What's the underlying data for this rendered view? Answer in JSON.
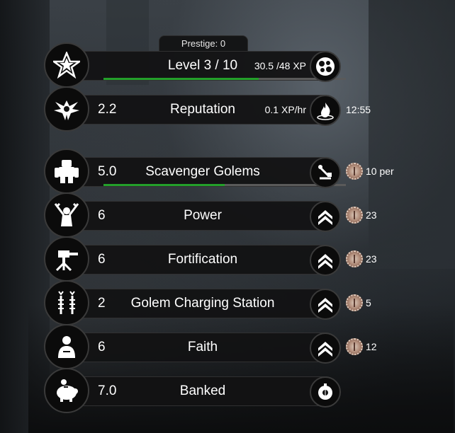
{
  "prestige": "Prestige: 0",
  "level": {
    "title": "Level 3 / 10",
    "xp": "30.5 /48 XP",
    "progress": 0.64
  },
  "reputation": {
    "value": "2.2",
    "title": "Reputation",
    "rate": "0.1 XP/hr",
    "timer": "12:55"
  },
  "golems": {
    "value": "5.0",
    "title": "Scavenger Golems",
    "cost": "10 per",
    "progress": 0.5
  },
  "upgrades": [
    {
      "value": "6",
      "title": "Power",
      "cost": "23"
    },
    {
      "value": "6",
      "title": "Fortification",
      "cost": "23"
    },
    {
      "value": "2",
      "title": "Golem Charging Station",
      "cost": "5"
    },
    {
      "value": "6",
      "title": "Faith",
      "cost": "12"
    }
  ],
  "banked": {
    "value": "7.0",
    "title": "Banked"
  },
  "colors": {
    "progress": "#23a02a",
    "bar": "#121213"
  },
  "icons": {
    "level": "star-icon",
    "xp": "orbs-icon",
    "reputation": "phoenix-icon",
    "rate": "flame-icon",
    "golems": "golem-icon",
    "scavenge": "scavenge-icon",
    "power": "power-icon",
    "fortification": "turret-icon",
    "charging": "tesla-icon",
    "faith": "monk-icon",
    "banked": "piggy-bank-icon",
    "upgrade": "chevron-up-icon",
    "cost": "gear-coin-icon",
    "vault": "vault-icon"
  }
}
